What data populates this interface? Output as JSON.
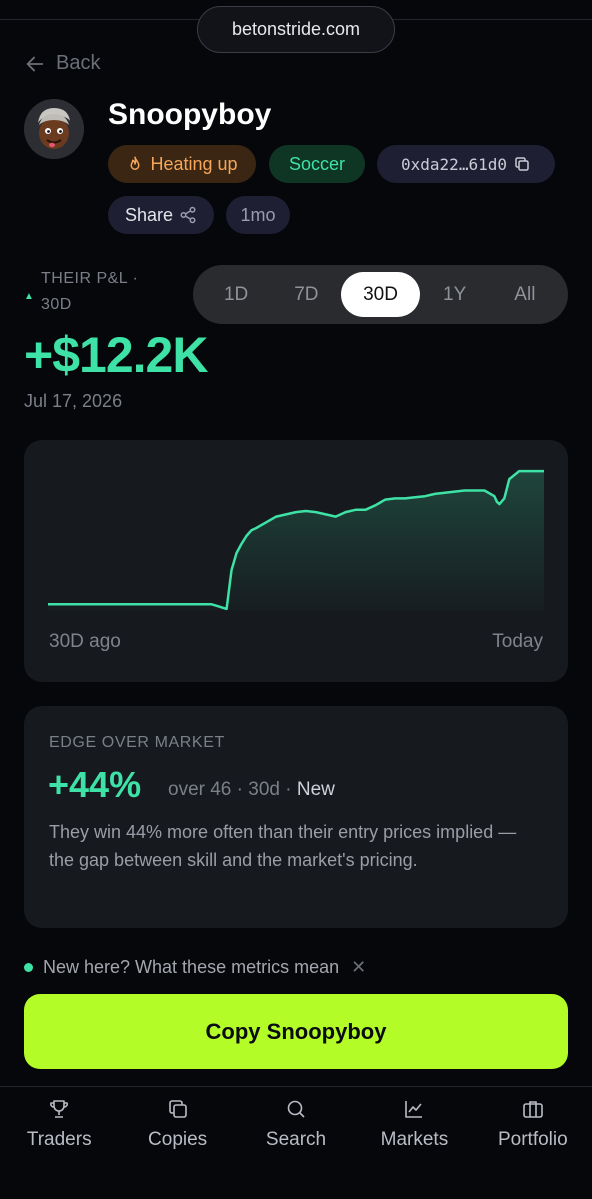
{
  "browser": {
    "url": "betonstride.com"
  },
  "nav": {
    "back_label": "Back"
  },
  "profile": {
    "name": "Snoopyboy",
    "tags": {
      "heat": "Heating up",
      "sport": "Soccer",
      "address": "0xda22…61d0"
    },
    "share_label": "Share",
    "age": "1mo"
  },
  "pnl": {
    "label": "THEIR P&L · 30D",
    "value": "+$12.2K",
    "date": "Jul 17, 2026",
    "ranges": [
      "1D",
      "7D",
      "30D",
      "1Y",
      "All"
    ],
    "active_range": "30D"
  },
  "chart_data": {
    "type": "area",
    "x_labels": [
      "30D ago",
      "Today"
    ],
    "x": [
      0,
      0.03,
      0.06,
      0.1,
      0.15,
      0.2,
      0.25,
      0.3,
      0.33,
      0.345,
      0.36,
      0.37,
      0.38,
      0.39,
      0.4,
      0.41,
      0.42,
      0.44,
      0.46,
      0.48,
      0.5,
      0.52,
      0.54,
      0.56,
      0.58,
      0.6,
      0.62,
      0.64,
      0.66,
      0.68,
      0.7,
      0.72,
      0.74,
      0.76,
      0.78,
      0.8,
      0.82,
      0.84,
      0.86,
      0.88,
      0.9,
      0.905,
      0.91,
      0.92,
      0.93,
      0.95,
      0.97,
      0.99,
      1.0
    ],
    "values": [
      0.5,
      0.5,
      0.5,
      0.5,
      0.5,
      0.5,
      0.5,
      0.5,
      0.5,
      0.3,
      0.1,
      3.5,
      5.0,
      5.8,
      6.5,
      7.0,
      7.2,
      7.7,
      8.2,
      8.4,
      8.6,
      8.7,
      8.6,
      8.4,
      8.2,
      8.6,
      8.8,
      8.8,
      9.2,
      9.7,
      9.8,
      9.8,
      9.9,
      10.0,
      10.2,
      10.3,
      10.4,
      10.5,
      10.5,
      10.5,
      10.0,
      9.5,
      9.3,
      9.8,
      11.5,
      12.2,
      12.2,
      12.2,
      12.2
    ],
    "ylim": [
      0,
      13
    ],
    "color": "#3ee2a6"
  },
  "edge": {
    "title": "EDGE OVER MARKET",
    "value": "+44%",
    "meta_prefix": "over 46 · 30d · ",
    "meta_status": "New",
    "description": "They win 44% more often than their entry prices implied — the gap between skill and the market's pricing."
  },
  "help": {
    "text": "New here? What these metrics mean"
  },
  "cta": {
    "label": "Copy Snoopyboy"
  },
  "tabbar": {
    "tabs": [
      {
        "label": "Traders",
        "icon": "trophy-icon"
      },
      {
        "label": "Copies",
        "icon": "copy-icon"
      },
      {
        "label": "Search",
        "icon": "search-icon"
      },
      {
        "label": "Markets",
        "icon": "chart-line-icon"
      },
      {
        "label": "Portfolio",
        "icon": "briefcase-icon"
      }
    ]
  },
  "colors": {
    "accent_green": "#3ee2a6",
    "cta_lime": "#b3fc28",
    "heat_orange": "#f6a65a",
    "background": "#06070b",
    "card": "#16191e"
  }
}
